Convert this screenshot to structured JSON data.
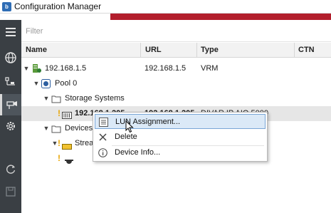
{
  "window": {
    "title": "Configuration Manager",
    "app_icon_glyph": "b"
  },
  "filter": {
    "placeholder": "Filter",
    "value": ""
  },
  "columns": {
    "name": "Name",
    "url": "URL",
    "type": "Type",
    "ctn": "CTN"
  },
  "sidebar": {
    "items": [
      {
        "icon": "hamburger-menu-icon"
      },
      {
        "icon": "network-globe-icon"
      },
      {
        "icon": "devices-map-icon"
      },
      {
        "icon": "cameras-icon",
        "active": true
      },
      {
        "icon": "gear-settings-icon"
      },
      {
        "icon": "refresh-icon"
      },
      {
        "icon": "save-icon"
      }
    ]
  },
  "tree": {
    "vrm_ip": "192.168.1.5",
    "vrm_url": "192.168.1.5",
    "vrm_type": "VRM",
    "pool": "Pool 0",
    "storage_systems": "Storage Systems",
    "storage_device": "192.168.1.205",
    "storage_device_url": "192.168.1.205",
    "storage_device_type": "DIVAR IP AIO 5000",
    "devices": "Devices",
    "stream_group": "Strea",
    "warn_glyph": "!"
  },
  "context_menu": {
    "items": [
      {
        "label": "LUN Assignment...",
        "icon": "lun-list-icon",
        "hover": true
      },
      {
        "label": "Delete",
        "icon": "delete-x-icon"
      },
      {
        "label": "Device Info...",
        "icon": "info-icon"
      }
    ]
  },
  "colors": {
    "accent_red": "#b21e2c",
    "sidebar_bg": "#3a3f44",
    "hover_bg": "#dbe9f7",
    "hover_border": "#7aa6d6",
    "warning": "#e8a400"
  }
}
